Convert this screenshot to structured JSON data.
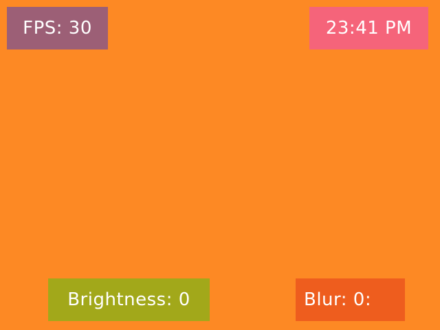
{
  "screen": {
    "background_color": "#fd8924"
  },
  "overlays": {
    "fps": {
      "text": "FPS: 30",
      "background_color": "#9c5f76"
    },
    "clock": {
      "text": "23:41 PM",
      "background_color": "#f5647a"
    },
    "brightness": {
      "text": "Brightness: 0",
      "background_color": "#a2a81a"
    },
    "blur": {
      "text": "Blur: 0:",
      "background_color": "#ee5d1e"
    }
  }
}
